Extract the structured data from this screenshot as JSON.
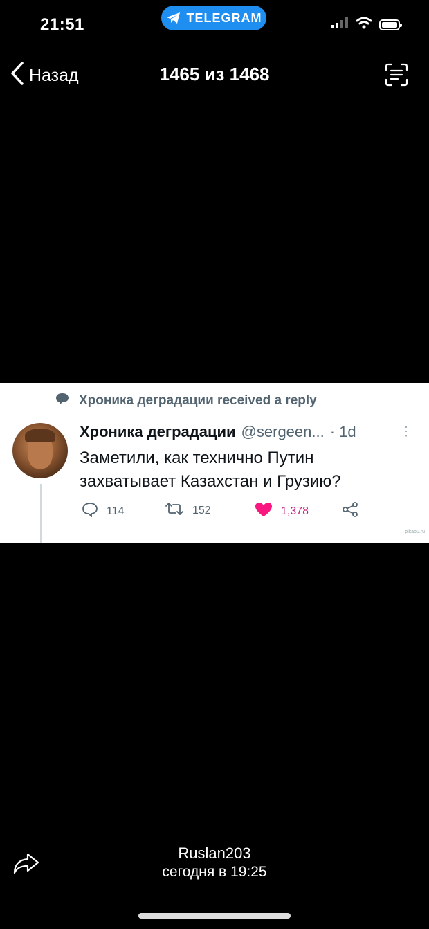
{
  "status_bar": {
    "time": "21:51",
    "telegram_label": "TELEGRAM"
  },
  "nav": {
    "back_label": "Назад",
    "counter": "1465 из 1468"
  },
  "post": {
    "reply_context": "Хроника деградации received a reply",
    "author_name": "Хроника деградации",
    "author_handle": "@sergeen...",
    "age": "· 1d",
    "text": "Заметили, как технично Путин захватывает Казахстан и Грузию?",
    "replies": "114",
    "retweets": "152",
    "likes": "1,378",
    "watermark": "pikabu.ru"
  },
  "footer": {
    "sender": "Ruslan203",
    "sent_time": "сегодня в 19:25"
  },
  "colors": {
    "telegram_blue": "#1f8ef1",
    "like_pink": "#f91880",
    "like_text": "#c01a7a"
  }
}
